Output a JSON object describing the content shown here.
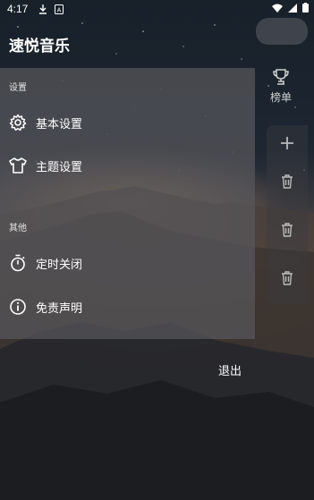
{
  "status_bar": {
    "time": "4:17"
  },
  "drawer": {
    "title": "速悦音乐",
    "sections": [
      {
        "label": "设置",
        "items": [
          {
            "label": "基本设置",
            "icon": "gear-icon"
          },
          {
            "label": "主题设置",
            "icon": "tshirt-icon"
          }
        ]
      },
      {
        "label": "其他",
        "items": [
          {
            "label": "定时关闭",
            "icon": "timer-icon"
          },
          {
            "label": "免责声明",
            "icon": "info-icon"
          }
        ]
      }
    ]
  },
  "background_tab": {
    "label": "榜单",
    "icon": "trophy-icon"
  },
  "exit_label": "退出",
  "colors": {
    "drawer_bg": "#58585c",
    "text": "#ffffff"
  }
}
